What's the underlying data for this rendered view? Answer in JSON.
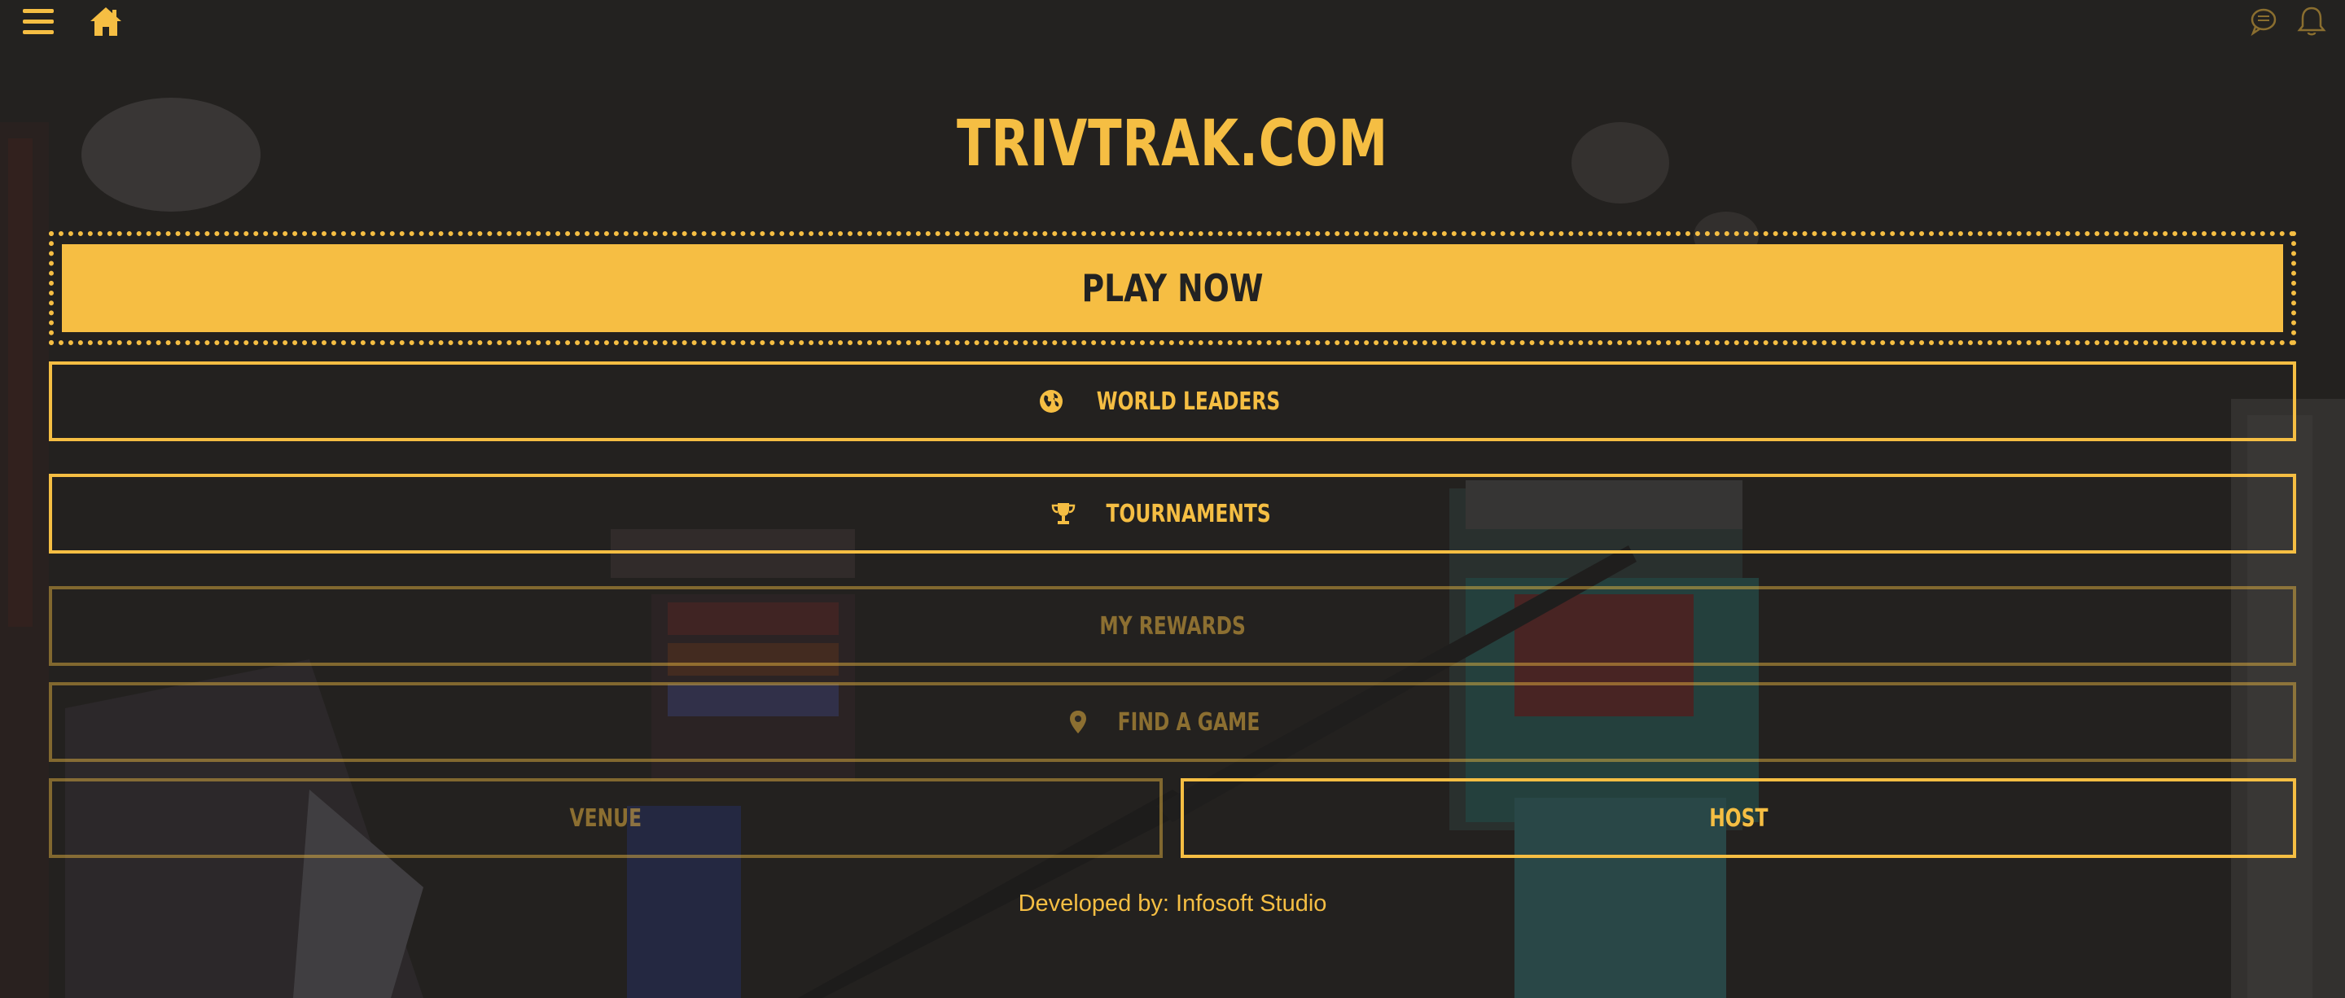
{
  "topbar": {
    "menu_icon": "hamburger-menu-icon",
    "home_icon": "home-icon",
    "chat_icon": "chat-bubble-icon",
    "bell_icon": "bell-icon"
  },
  "header": {
    "title": "TRIVTRAK.COM"
  },
  "menu": {
    "play_now": "PLAY NOW",
    "world_leaders": {
      "label": "WORLD LEADERS",
      "icon": "globe-icon"
    },
    "tournaments": {
      "label": "TOURNAMENTS",
      "icon": "trophy-icon"
    },
    "my_rewards": {
      "label": "MY REWARDS"
    },
    "find_a_game": {
      "label": "FIND A GAME",
      "icon": "map-pin-icon"
    },
    "venue": {
      "label": "VENUE"
    },
    "host": {
      "label": "HOST"
    }
  },
  "footer": {
    "credit": "Developed by: Infosoft Studio"
  },
  "colors": {
    "accent": "#f5be43",
    "background": "#232220",
    "button_text_dark": "#222222"
  }
}
